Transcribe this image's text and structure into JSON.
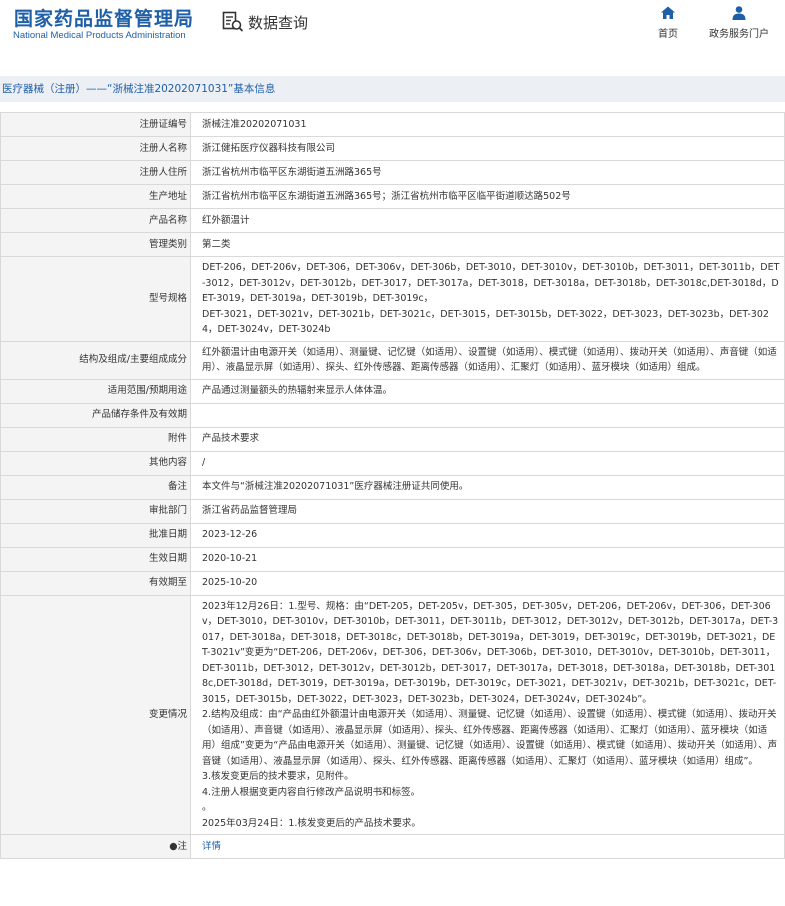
{
  "header": {
    "logo_cn": "国家药品监督管理局",
    "logo_en": "National Medical Products Administration",
    "data_query": "数据查询",
    "nav_home": "首页",
    "nav_gov": "政务服务门户"
  },
  "title": "医疗器械（注册）——“浙械注准20202071031”基本信息",
  "rows": [
    {
      "label": "注册证编号",
      "value": "浙械注准20202071031"
    },
    {
      "label": "注册人名称",
      "value": "浙江健拓医疗仪器科技有限公司"
    },
    {
      "label": "注册人住所",
      "value": "浙江省杭州市临平区东湖街道五洲路365号"
    },
    {
      "label": "生产地址",
      "value": "浙江省杭州市临平区东湖街道五洲路365号；浙江省杭州市临平区临平街道顺达路502号"
    },
    {
      "label": "产品名称",
      "value": "红外额温计"
    },
    {
      "label": "管理类别",
      "value": "第二类"
    },
    {
      "label": "型号规格",
      "value": "DET-206，DET-206v，DET-306，DET-306v，DET-306b，DET-3010，DET-3010v，DET-3010b，DET-3011，DET-3011b，DET-3012，DET-3012v，DET-3012b，DET-3017，DET-3017a，DET-3018，DET-3018a，DET-3018b，DET-3018c,DET-3018d，DET-3019，DET-3019a，DET-3019b，DET-3019c，\nDET-3021，DET-3021v，DET-3021b，DET-3021c，DET-3015，DET-3015b，DET-3022，DET-3023，DET-3023b，DET-3024，DET-3024v，DET-3024b"
    },
    {
      "label": "结构及组成/主要组成成分",
      "value": "红外额温计由电源开关（如适用）、测量键、记忆键（如适用）、设置键（如适用）、模式键（如适用）、拨动开关（如适用）、声音键（如适用）、液晶显示屏（如适用）、探头、红外传感器、距离传感器（如适用）、汇聚灯（如适用）、蓝牙模块（如适用）组成。"
    },
    {
      "label": "适用范围/预期用途",
      "value": "产品通过测量额头的热辐射来显示人体体温。"
    },
    {
      "label": "产品储存条件及有效期",
      "value": ""
    },
    {
      "label": "附件",
      "value": "产品技术要求"
    },
    {
      "label": "其他内容",
      "value": "/"
    },
    {
      "label": "备注",
      "value": "本文件与“浙械注准20202071031”医疗器械注册证共同使用。"
    },
    {
      "label": "审批部门",
      "value": "浙江省药品监督管理局"
    },
    {
      "label": "批准日期",
      "value": "2023-12-26"
    },
    {
      "label": "生效日期",
      "value": "2020-10-21"
    },
    {
      "label": "有效期至",
      "value": "2025-10-20"
    }
  ],
  "change": {
    "label": "变更情况",
    "paragraphs": [
      "2023年12月26日：1.型号、规格：由“DET-205，DET-205v，DET-305，DET-305v，DET-206，DET-206v，DET-306，DET-306v，DET-3010，DET-3010v，DET-3010b，DET-3011，DET-3011b，DET-3012，DET-3012v，DET-3012b，DET-3017a，DET-3017，DET-3018a，DET-3018，DET-3018c，DET-3018b，DET-3019a，DET-3019，DET-3019c，DET-3019b，DET-3021，DET-3021v”变更为“DET-206，DET-206v，DET-306，DET-306v，DET-306b，DET-3010，DET-3010v，DET-3010b，DET-3011，DET-3011b，DET-3012，DET-3012v，DET-3012b，DET-3017，DET-3017a，DET-3018，DET-3018a，DET-3018b，DET-3018c,DET-3018d，DET-3019，DET-3019a，DET-3019b，DET-3019c，DET-3021，DET-3021v，DET-3021b，DET-3021c，DET-3015，DET-3015b，DET-3022，DET-3023，DET-3023b，DET-3024，DET-3024v，DET-3024b”。",
      "2.结构及组成：由“产品由红外额温计由电源开关（如适用）、测量键、记忆键（如适用）、设置键（如适用）、模式键（如适用）、拨动开关（如适用）、声音键（如适用）、液晶显示屏（如适用）、探头、红外传感器、距离传感器（如适用）、汇聚灯（如适用）、蓝牙模块（如适用）组成”变更为“产品由电源开关（如适用）、测量键、记忆键（如适用）、设置键（如适用）、模式键（如适用）、拨动开关（如适用）、声音键（如适用）、液晶显示屏（如适用）、探头、红外传感器、距离传感器（如适用）、汇聚灯（如适用）、蓝牙模块（如适用）组成”。",
      "3.核发变更后的技术要求，见附件。",
      "4.注册人根据变更内容自行修改产品说明书和标签。",
      "。",
      "2025年03月24日：1.核发变更后的产品技术要求。"
    ]
  },
  "note": {
    "label": "●注",
    "value": "详情"
  }
}
